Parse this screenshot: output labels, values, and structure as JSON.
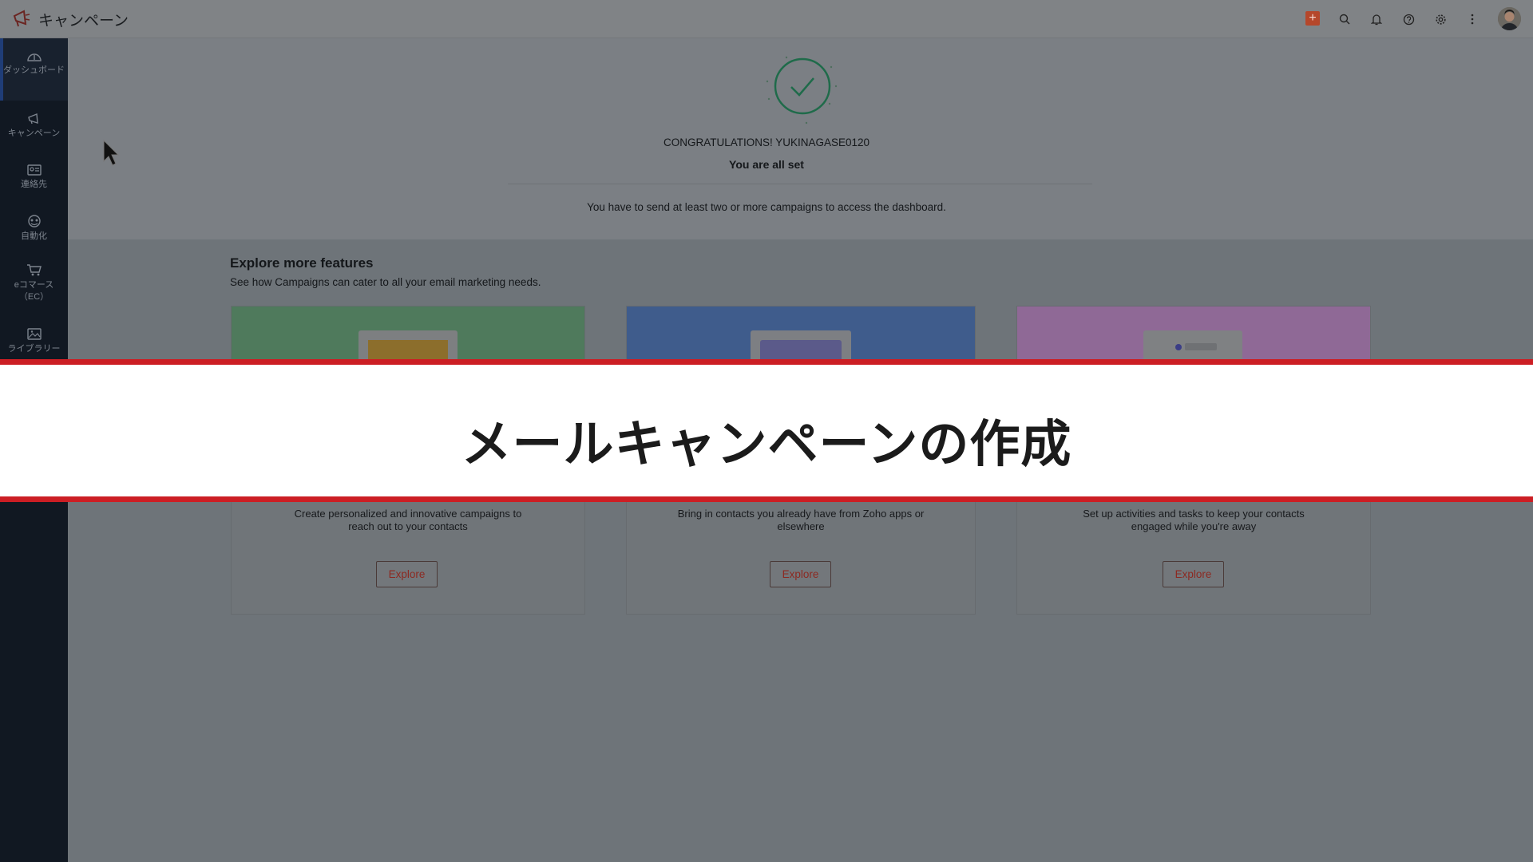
{
  "header": {
    "app_title": "キャンペーン",
    "icons": [
      "plus-icon",
      "search-icon",
      "bell-icon",
      "help-icon",
      "gear-icon",
      "more-vertical-icon"
    ]
  },
  "sidebar": {
    "items": [
      {
        "label": "ダッシュボード",
        "icon": "dashboard-icon",
        "active": true
      },
      {
        "label": "キャンペーン",
        "icon": "megaphone-icon",
        "active": false
      },
      {
        "label": "連絡先",
        "icon": "contact-card-icon",
        "active": false
      },
      {
        "label": "自動化",
        "icon": "automation-icon",
        "active": false
      },
      {
        "label": "eコマース（EC）",
        "icon": "cart-icon",
        "active": false
      },
      {
        "label": "ライブラリー",
        "icon": "image-library-icon",
        "active": false
      }
    ]
  },
  "welcome": {
    "congrats": "CONGRATULATIONS! YUKINAGASE0120",
    "all_set": "You are all set",
    "notice": "You have to send at least two or more campaigns to access the dashboard."
  },
  "explore": {
    "title": "Explore more features",
    "subtitle": "See how Campaigns can cater to all your email marketing needs.",
    "cards": [
      {
        "color": "#4f7a5c",
        "desc_line1": "Create personalized and innovative campaigns to",
        "desc_line2": "reach out to your contacts",
        "button": "Explore"
      },
      {
        "color": "#3f5c8c",
        "desc_line1": "Bring in contacts you already have from Zoho apps or",
        "desc_line2": "elsewhere",
        "button": "Explore"
      },
      {
        "color": "#8f6996",
        "desc_line1": "Set up activities and tasks to keep your contacts",
        "desc_line2": "engaged while you're away",
        "button": "Explore"
      }
    ]
  },
  "banner": {
    "text": "メールキャンペーンの作成",
    "border_color": "#cc1e24"
  },
  "colors": {
    "accent": "#b5472b",
    "sidebar_bg": "#111822",
    "button_text": "#8c2a22"
  }
}
